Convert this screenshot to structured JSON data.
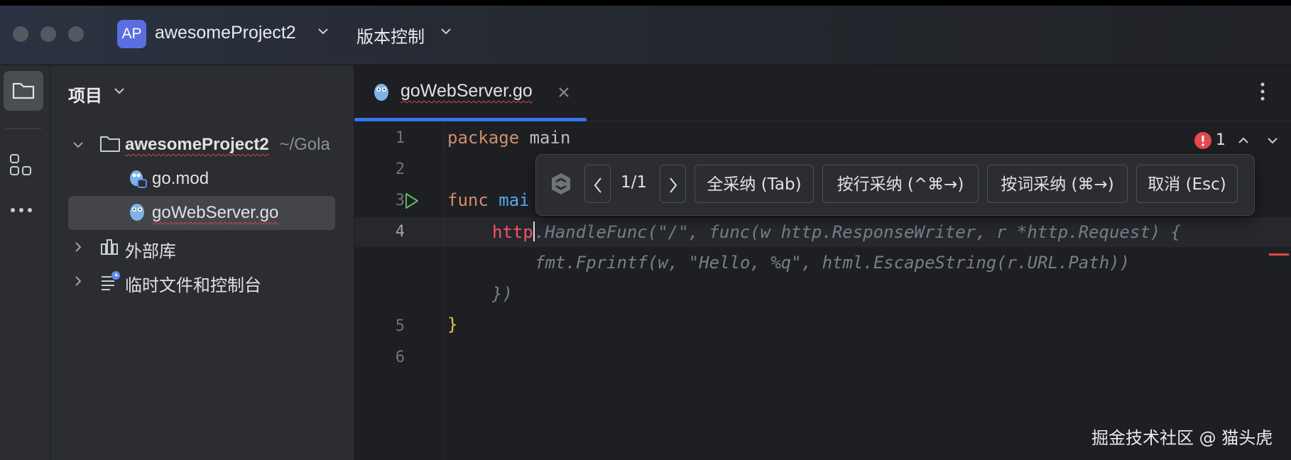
{
  "window": {
    "project_badge": "AP",
    "project_name": "awesomeProject2",
    "vcs_menu": "版本控制"
  },
  "toolstrip": {
    "icons": [
      "folder-icon",
      "structure-icon",
      "more-icon"
    ]
  },
  "project_panel": {
    "title": "项目",
    "root": {
      "name": "awesomeProject2",
      "path": "~/Gola"
    },
    "files": [
      "go.mod",
      "goWebServer.go"
    ],
    "external_libs": "外部库",
    "scratches": "临时文件和控制台"
  },
  "editor": {
    "tab_label": "goWebServer.go",
    "line_numbers": [
      "1",
      "2",
      "3",
      "4",
      "5",
      "6"
    ],
    "line1_kw": "package",
    "line1_name": "main",
    "line3_kw": "func",
    "line3_name": "mai",
    "line4_prefix": "http",
    "ghost_line1": ".HandleFunc(\"/\", func(w http.ResponseWriter, r *http.Request) {",
    "ghost_line2": "fmt.Fprintf(w, \"Hello, %q\", html.EscapeString(r.URL.Path))",
    "ghost_line3": "})",
    "closing_brace": "}",
    "error_count": "1"
  },
  "completion_popup": {
    "counter": "1/1",
    "accept_all": "全采纳 (Tab)",
    "accept_line": "按行采纳 (^⌘→)",
    "accept_word": "按词采纳 (⌘→)",
    "cancel": "取消 (Esc)"
  },
  "watermark": "掘金技术社区 @ 猫头虎"
}
